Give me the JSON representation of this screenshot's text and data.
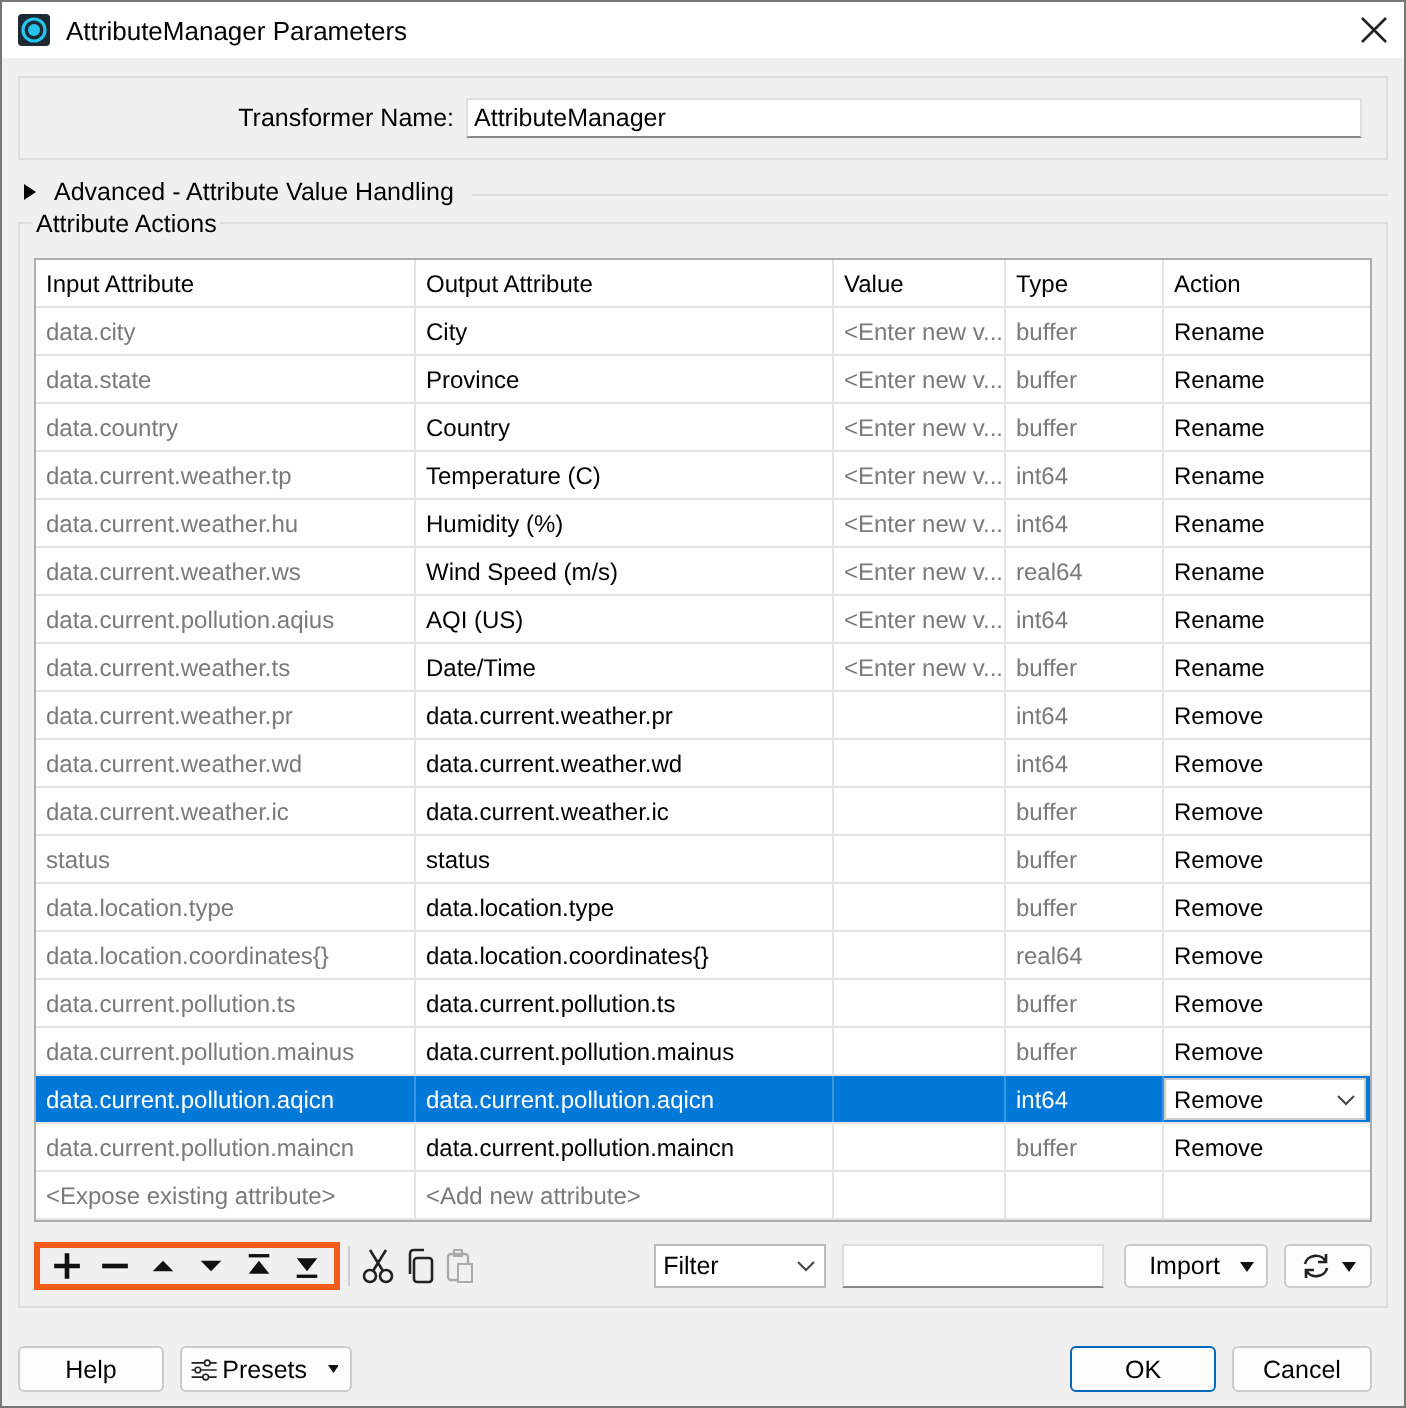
{
  "window": {
    "title": "AttributeManager Parameters"
  },
  "transformer_name": {
    "label": "Transformer Name:",
    "value": "AttributeManager"
  },
  "advanced": {
    "label": "Advanced - Attribute Value Handling",
    "expanded": false
  },
  "attribute_actions": {
    "title": "Attribute Actions",
    "columns": [
      "Input Attribute",
      "Output Attribute",
      "Value",
      "Type",
      "Action"
    ],
    "rows": [
      {
        "input": "data.city",
        "output": "City",
        "value": "<Enter new v...",
        "type": "buffer",
        "action": "Rename",
        "selected": false
      },
      {
        "input": "data.state",
        "output": "Province",
        "value": "<Enter new v...",
        "type": "buffer",
        "action": "Rename",
        "selected": false
      },
      {
        "input": "data.country",
        "output": "Country",
        "value": "<Enter new v...",
        "type": "buffer",
        "action": "Rename",
        "selected": false
      },
      {
        "input": "data.current.weather.tp",
        "output": "Temperature (C)",
        "value": "<Enter new v...",
        "type": "int64",
        "action": "Rename",
        "selected": false
      },
      {
        "input": "data.current.weather.hu",
        "output": "Humidity (%)",
        "value": "<Enter new v...",
        "type": "int64",
        "action": "Rename",
        "selected": false
      },
      {
        "input": "data.current.weather.ws",
        "output": "Wind Speed (m/s)",
        "value": "<Enter new v...",
        "type": "real64",
        "action": "Rename",
        "selected": false
      },
      {
        "input": "data.current.pollution.aqius",
        "output": "AQI (US)",
        "value": "<Enter new v...",
        "type": "int64",
        "action": "Rename",
        "selected": false
      },
      {
        "input": "data.current.weather.ts",
        "output": "Date/Time",
        "value": "<Enter new v...",
        "type": "buffer",
        "action": "Rename",
        "selected": false
      },
      {
        "input": "data.current.weather.pr",
        "output": "data.current.weather.pr",
        "type": "int64",
        "action": "Remove",
        "selected": false
      },
      {
        "input": "data.current.weather.wd",
        "output": "data.current.weather.wd",
        "type": "int64",
        "action": "Remove",
        "selected": false
      },
      {
        "input": "data.current.weather.ic",
        "output": "data.current.weather.ic",
        "type": "buffer",
        "action": "Remove",
        "selected": false
      },
      {
        "input": "status",
        "output": "status",
        "type": "buffer",
        "action": "Remove",
        "selected": false
      },
      {
        "input": "data.location.type",
        "output": "data.location.type",
        "type": "buffer",
        "action": "Remove",
        "selected": false
      },
      {
        "input": "data.location.coordinates{}",
        "output": "data.location.coordinates{}",
        "type": "real64",
        "action": "Remove",
        "selected": false
      },
      {
        "input": "data.current.pollution.ts",
        "output": "data.current.pollution.ts",
        "type": "buffer",
        "action": "Remove",
        "selected": false
      },
      {
        "input": "data.current.pollution.mainus",
        "output": "data.current.pollution.mainus",
        "type": "buffer",
        "action": "Remove",
        "selected": false
      },
      {
        "input": "data.current.pollution.aqicn",
        "output": "data.current.pollution.aqicn",
        "type": "int64",
        "action": "Remove",
        "selected": true
      },
      {
        "input": "data.current.pollution.maincn",
        "output": "data.current.pollution.maincn",
        "type": "buffer",
        "action": "Remove",
        "selected": false
      }
    ],
    "new_row": {
      "input": "<Expose existing attribute>",
      "output": "<Add new attribute>"
    }
  },
  "toolbar": {
    "move_buttons_highlighted": true,
    "paste_disabled": true,
    "filter": "Filter",
    "import": "Import"
  },
  "buttons": {
    "help": "Help",
    "presets": "Presets",
    "ok": "OK",
    "cancel": "Cancel"
  }
}
